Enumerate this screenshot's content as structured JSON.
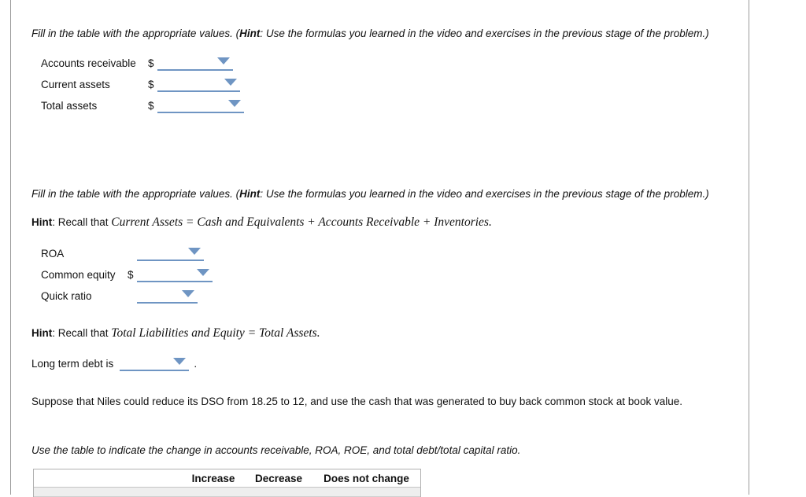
{
  "section1": {
    "prompt_pre": "Fill in the table with the appropriate values. (",
    "prompt_hint_word": "Hint",
    "prompt_post": ": Use the formulas you learned in the video and exercises in the previous stage of the problem.)",
    "rows": [
      {
        "label": "Accounts receivable",
        "currency": "$",
        "value": ""
      },
      {
        "label": "Current assets",
        "currency": "$",
        "value": ""
      },
      {
        "label": "Total assets",
        "currency": "$",
        "value": ""
      }
    ]
  },
  "section2": {
    "prompt_pre": "Fill in the table with the appropriate values. (",
    "prompt_hint_word": "Hint",
    "prompt_post": ": Use the formulas you learned in the video and exercises in the previous stage of the problem.)",
    "hint_label": "Hint",
    "hint_lead": ": Recall that ",
    "hint_formula": "Current Assets = Cash and Equivalents + Accounts Receivable + Inventories",
    "hint_trail": ".",
    "rows": [
      {
        "label": "ROA",
        "currency": "",
        "value": ""
      },
      {
        "label": "Common equity",
        "currency": "$",
        "value": ""
      },
      {
        "label": "Quick ratio",
        "currency": "",
        "value": ""
      }
    ]
  },
  "section3": {
    "hint_label": "Hint",
    "hint_lead": ": Recall that ",
    "hint_formula": "Total Liabilities and Equity = Total Assets",
    "hint_trail": ".",
    "ltd_prefix": "Long term debt is",
    "ltd_value": "",
    "ltd_suffix": "."
  },
  "section4": {
    "paragraph": "Suppose that Niles could reduce its DSO from 18.25 to 12, and use the cash that was generated to buy back common stock at book value.",
    "instruction": "Use the table to indicate the change in accounts receivable, ROA, ROE, and total debt/total capital ratio."
  },
  "change_table": {
    "blank_header": "",
    "headers": [
      "Increase",
      "Decrease",
      "Does not change"
    ]
  },
  "colors": {
    "select_blue": "#6f95c3",
    "rule_gray": "#9a9a9a",
    "table_border": "#b5b5b5",
    "table_row_fill": "#eeeeee",
    "text": "#121212"
  }
}
